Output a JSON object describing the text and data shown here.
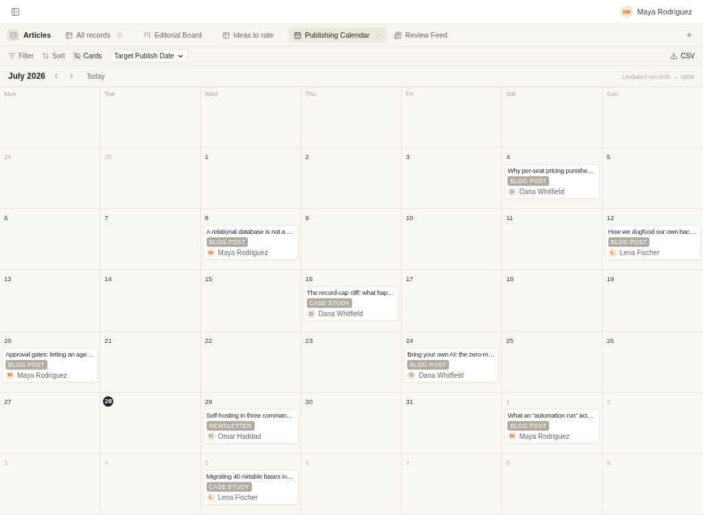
{
  "header": {
    "user": {
      "initials": "MR",
      "name": "Maya Rodriguez",
      "color": "#fce4d3"
    }
  },
  "base": {
    "name": "Articles"
  },
  "view_tabs": [
    {
      "label": "All records",
      "kind": "table",
      "pinned": true,
      "selected": false
    },
    {
      "label": "Editorial Board",
      "kind": "board",
      "pinned": false,
      "selected": false
    },
    {
      "label": "Ideas to rate",
      "kind": "table",
      "pinned": false,
      "selected": false
    },
    {
      "label": "Publishing Calendar",
      "kind": "calendar",
      "pinned": false,
      "selected": true
    },
    {
      "label": "Review Feed",
      "kind": "feed",
      "pinned": false,
      "selected": false
    }
  ],
  "toolbar": {
    "buttons": [
      {
        "label": "Filter",
        "kind": "filter"
      },
      {
        "label": "Sort",
        "kind": "sort"
      },
      {
        "label": "Cards",
        "kind": "hide"
      }
    ],
    "date_field": {
      "value": "Target Publish Date"
    },
    "export": {
      "label": "CSV"
    }
  },
  "calendar": {
    "month": "July 2026",
    "today_button": "Today",
    "undated_link": "Undated records → table",
    "weekdays": [
      "Mon",
      "Tue",
      "Wed",
      "Thu",
      "Fri",
      "Sat",
      "Sun"
    ],
    "weeks": [
      {
        "days": [
          {
            "day": "29",
            "outside_month": true,
            "today": false
          },
          {
            "day": "30",
            "outside_month": true,
            "today": false
          },
          {
            "day": "1",
            "outside_month": false,
            "today": false
          },
          {
            "day": "2",
            "outside_month": false,
            "today": false
          },
          {
            "day": "3",
            "outside_month": false,
            "today": false
          },
          {
            "day": "4",
            "outside_month": false,
            "today": false,
            "events": [
              {
                "title": "Why per-seat pricing punishe…",
                "tag": "BLOG POST",
                "author": {
                  "initial": "D",
                  "name": "Dana Whitfield",
                  "color": "#ebe7df"
                }
              }
            ]
          },
          {
            "day": "5",
            "outside_month": false,
            "today": false
          }
        ]
      },
      {
        "days": [
          {
            "day": "6",
            "outside_month": false,
            "today": false
          },
          {
            "day": "7",
            "outside_month": false,
            "today": false
          },
          {
            "day": "8",
            "outside_month": false,
            "today": false,
            "events": [
              {
                "title": "A relational database is not a …",
                "tag": "BLOG POST",
                "author": {
                  "initial": "M",
                  "name": "Maya Rodriguez",
                  "color": "#fce6d6"
                }
              }
            ]
          },
          {
            "day": "9",
            "outside_month": false,
            "today": false
          },
          {
            "day": "10",
            "outside_month": false,
            "today": false
          },
          {
            "day": "11",
            "outside_month": false,
            "today": false
          },
          {
            "day": "12",
            "outside_month": false,
            "today": false,
            "events": [
              {
                "title": "How we dogfood our own bac…",
                "tag": "BLOG POST",
                "author": {
                  "initial": "L",
                  "name": "Lena Fischer",
                  "color": "#fce6d6"
                }
              }
            ]
          }
        ]
      },
      {
        "days": [
          {
            "day": "13",
            "outside_month": false,
            "today": false
          },
          {
            "day": "14",
            "outside_month": false,
            "today": false
          },
          {
            "day": "15",
            "outside_month": false,
            "today": false
          },
          {
            "day": "16",
            "outside_month": false,
            "today": false,
            "events": [
              {
                "title": "The record-cap cliff: what hap…",
                "tag": "CASE STUDY",
                "author": {
                  "initial": "D",
                  "name": "Dana Whitfield",
                  "color": "#ebe7df"
                }
              }
            ]
          },
          {
            "day": "17",
            "outside_month": false,
            "today": false
          },
          {
            "day": "18",
            "outside_month": false,
            "today": false
          },
          {
            "day": "19",
            "outside_month": false,
            "today": false
          }
        ]
      },
      {
        "days": [
          {
            "day": "20",
            "outside_month": false,
            "today": false,
            "events": [
              {
                "title": "Approval gates: letting an age…",
                "tag": "BLOG POST",
                "author": {
                  "initial": "M",
                  "name": "Maya Rodriguez",
                  "color": "#fce6d6"
                }
              }
            ]
          },
          {
            "day": "21",
            "outside_month": false,
            "today": false
          },
          {
            "day": "22",
            "outside_month": false,
            "today": false
          },
          {
            "day": "23",
            "outside_month": false,
            "today": false
          },
          {
            "day": "24",
            "outside_month": false,
            "today": false,
            "events": [
              {
                "title": "Bring your own AI: the zero-m…",
                "tag": "BLOG POST",
                "author": {
                  "initial": "D",
                  "name": "Dana Whitfield",
                  "color": "#ebe7df"
                }
              }
            ]
          },
          {
            "day": "25",
            "outside_month": false,
            "today": false
          },
          {
            "day": "26",
            "outside_month": false,
            "today": false
          }
        ]
      },
      {
        "days": [
          {
            "day": "27",
            "outside_month": false,
            "today": false
          },
          {
            "day": "28",
            "outside_month": false,
            "today": true
          },
          {
            "day": "29",
            "outside_month": false,
            "today": false,
            "events": [
              {
                "title": "Self-hosting in three comman…",
                "tag": "NEWSLETTER",
                "author": {
                  "initial": "O",
                  "name": "Omar Haddad",
                  "color": "#ebe7df"
                }
              }
            ]
          },
          {
            "day": "30",
            "outside_month": false,
            "today": false
          },
          {
            "day": "31",
            "outside_month": false,
            "today": false
          },
          {
            "day": "1",
            "outside_month": true,
            "today": false,
            "events": [
              {
                "title": "What an “automation run” act…",
                "tag": "BLOG POST",
                "author": {
                  "initial": "M",
                  "name": "Maya Rodriguez",
                  "color": "#fce6d6"
                }
              }
            ]
          },
          {
            "day": "2",
            "outside_month": true,
            "today": false
          }
        ]
      },
      {
        "days": [
          {
            "day": "3",
            "outside_month": true,
            "today": false
          },
          {
            "day": "4",
            "outside_month": true,
            "today": false
          },
          {
            "day": "5",
            "outside_month": true,
            "today": false,
            "events": [
              {
                "title": "Migrating 40 Airtable bases in…",
                "tag": "CASE STUDY",
                "author": {
                  "initial": "L",
                  "name": "Lena Fischer",
                  "color": "#fce6d6"
                }
              }
            ]
          },
          {
            "day": "6",
            "outside_month": true,
            "today": false
          },
          {
            "day": "7",
            "outside_month": true,
            "today": false
          },
          {
            "day": "8",
            "outside_month": true,
            "today": false
          },
          {
            "day": "9",
            "outside_month": true,
            "today": false
          }
        ]
      }
    ]
  }
}
